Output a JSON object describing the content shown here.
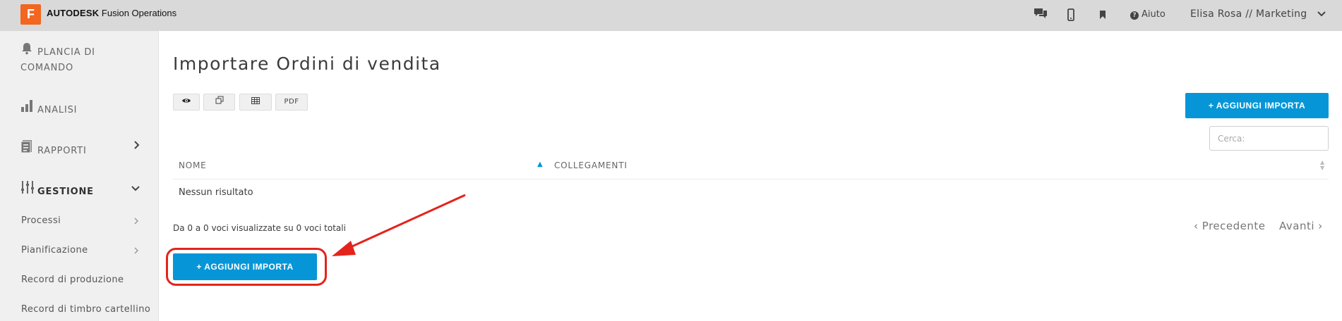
{
  "topbar": {
    "logo_letter": "F",
    "brand_bold": "AUTODESK",
    "brand_rest": " Fusion Operations",
    "icons": [
      "chat-icon",
      "mobile-icon",
      "bookmark-icon",
      "help-icon"
    ],
    "help_label": "Aiuto",
    "user_label": "Elisa Rosa // Marketing"
  },
  "sidebar": {
    "items": [
      {
        "icon": "bell-icon",
        "label": "PLANCIA DI COMANDO"
      },
      {
        "icon": "bar-chart-icon",
        "label": "ANALISI"
      },
      {
        "icon": "report-icon",
        "label": "RAPPORTI"
      },
      {
        "icon": "sliders-icon",
        "label": "GESTIONE"
      }
    ],
    "subitems": [
      {
        "label": "Processi"
      },
      {
        "label": "Pianificazione"
      },
      {
        "label": "Record di produzione"
      },
      {
        "label": "Record di timbro cartellino"
      }
    ]
  },
  "main": {
    "title": "Importare Ordini di vendita",
    "toolbar": {
      "pdf_label": "PDF"
    },
    "add_button_label": "AGGIUNGI IMPORTA",
    "add_icon": "+",
    "search_placeholder": "Cerca:",
    "table": {
      "headers": [
        "NOME",
        "COLLEGAMENTI"
      ],
      "empty_text": "Nessun risultato"
    },
    "info_text": "Da 0 a 0 voci visualizzate su 0 voci totali",
    "pager": {
      "prev": "Precedente",
      "next": "Avanti"
    }
  },
  "colors": {
    "accent": "#0696d7",
    "brand": "#f2661f",
    "annotation": "#e4231b",
    "topbar_bg": "#d9d9d9",
    "sidebar_bg": "#f0f0f0"
  }
}
